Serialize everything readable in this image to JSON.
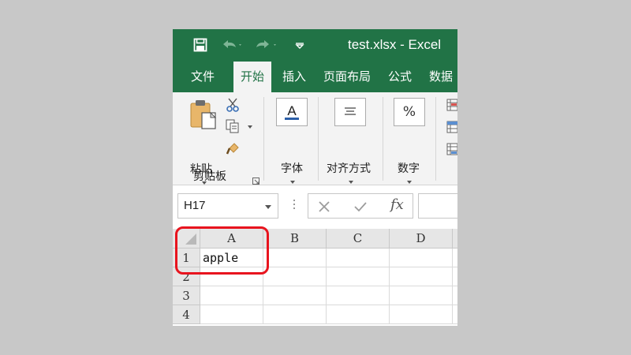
{
  "window": {
    "title": "test.xlsx  -  Excel"
  },
  "quick_access": {
    "icons": [
      "save-icon",
      "undo-icon",
      "redo-icon",
      "customize-dropdown-icon"
    ]
  },
  "tabs": [
    {
      "label": "文件",
      "active": false
    },
    {
      "label": "开始",
      "active": true
    },
    {
      "label": "插入",
      "active": false
    },
    {
      "label": "页面布局",
      "active": false
    },
    {
      "label": "公式",
      "active": false
    },
    {
      "label": "数据",
      "active": false
    }
  ],
  "ribbon": {
    "clipboard": {
      "paste_label": "粘贴",
      "group_label": "剪贴板",
      "icons": [
        "paste-icon",
        "cut-icon",
        "copy-icon",
        "format-painter-icon",
        "dialog-launcher-icon"
      ]
    },
    "font": {
      "label": "字体",
      "icon": "font-icon",
      "icon_glyph": "A"
    },
    "alignment": {
      "label": "对齐方式",
      "icon": "align-icon"
    },
    "number": {
      "label": "数字",
      "icon": "percent-icon",
      "icon_glyph": "%"
    }
  },
  "formula_bar": {
    "name_box_value": "H17",
    "fx_label": "fx",
    "formula_value": ""
  },
  "grid": {
    "columns": [
      "A",
      "B",
      "C",
      "D"
    ],
    "rows": [
      {
        "header": "1",
        "cells": [
          "apple",
          "",
          "",
          ""
        ]
      },
      {
        "header": "2",
        "cells": [
          "",
          "",
          "",
          ""
        ]
      },
      {
        "header": "3",
        "cells": [
          "",
          "",
          "",
          ""
        ]
      },
      {
        "header": "4",
        "cells": [
          "",
          "",
          "",
          ""
        ]
      }
    ]
  },
  "colors": {
    "brand": "#217346",
    "highlight": "#e8141e",
    "ribbon_bg": "#f3f3f3"
  }
}
